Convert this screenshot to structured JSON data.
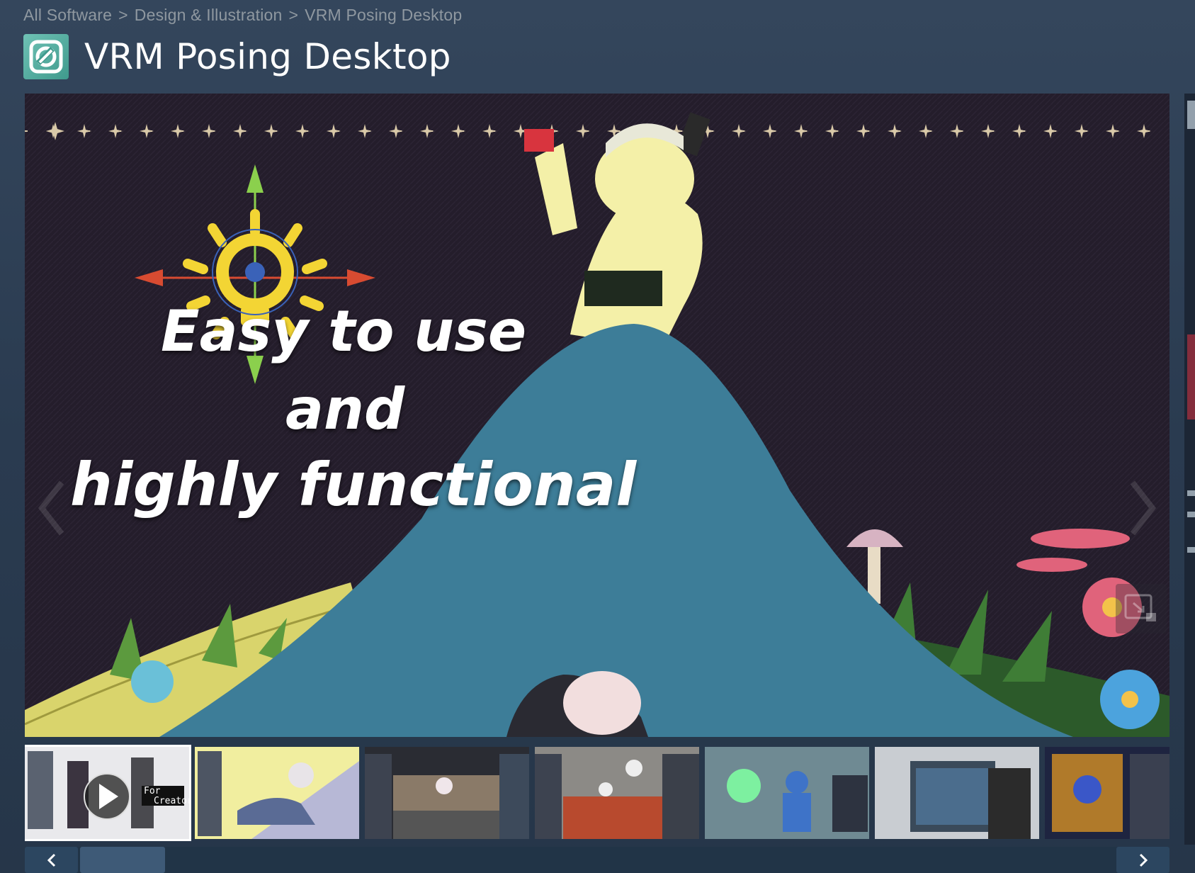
{
  "breadcrumb": {
    "items": [
      "All Software",
      "Design & Illustration",
      "VRM Posing Desktop"
    ],
    "separator": ">"
  },
  "app": {
    "title": "VRM Posing Desktop",
    "logo_icon": "vrm-logo-icon"
  },
  "media": {
    "overlay_lines": [
      "Easy to use",
      "and",
      "highly functional"
    ],
    "thumbnail_labels": [
      "For",
      "Creators"
    ],
    "thumbnail_count": 7,
    "active_thumbnail": 1
  },
  "colors": {
    "background": "#2a3b50",
    "accent_teal": "#3d7d98",
    "slider_bar": "#213447",
    "slider_handle": "#3e5a77"
  },
  "icons": {
    "prev": "chevron-left-icon",
    "next": "chevron-right-icon",
    "fullscreen": "fullscreen-icon",
    "play": "play-icon"
  }
}
